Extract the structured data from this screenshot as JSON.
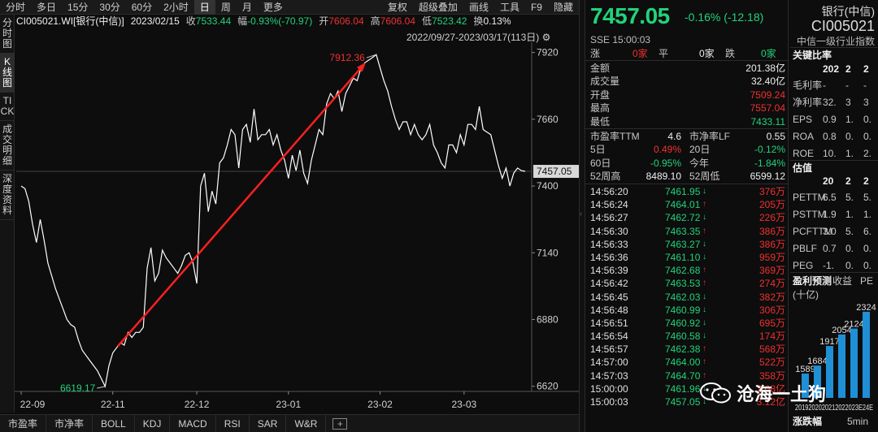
{
  "toolbar": {
    "items": [
      "分时",
      "多日",
      "15分",
      "30分",
      "60分",
      "2小时",
      "日",
      "周",
      "月",
      "更多"
    ],
    "active": "日",
    "right": [
      "复权",
      "超级叠加",
      "画线",
      "工具",
      "F9",
      "隐藏"
    ]
  },
  "leftnav": [
    "分时图",
    "K线图",
    "TICK",
    "成交明细",
    "深度资料"
  ],
  "leftnav_active": "K线图",
  "infobar": {
    "code": "CI005021.WI[银行(中信)]",
    "date": "2023/02/15",
    "close_label": "收",
    "close": "7533.44",
    "chg_label": "幅",
    "chg": "-0.93%(-70.97)",
    "open_label": "开",
    "open": "7606.04",
    "high_label": "高",
    "high": "7606.04",
    "low_label": "低",
    "low": "7523.42",
    "turnover_label": "换",
    "turnover": "0.13%"
  },
  "range": "2022/09/27-2023/03/17(113日)",
  "chart_data": {
    "type": "line",
    "y_ticks": [
      7920,
      7660,
      7400,
      7140,
      6880,
      6620
    ],
    "x_ticks": [
      "22-09",
      "22-11",
      "22-12",
      "23-01",
      "23-02",
      "23-03"
    ],
    "ylim": [
      6600,
      7960
    ],
    "last_price_label": "7457.05",
    "max_annotation": "7912.36",
    "min_annotation": "6619.17",
    "values": [
      7400,
      7390,
      7340,
      7250,
      7180,
      7270,
      7190,
      7100,
      7050,
      7000,
      6960,
      6920,
      6880,
      6860,
      6850,
      6800,
      6760,
      6740,
      6720,
      6700,
      6680,
      6650,
      6619,
      6700,
      6750,
      6770,
      6790,
      6780,
      6830,
      6810,
      6830,
      6830,
      6850,
      7080,
      7160,
      7030,
      7060,
      7150,
      7120,
      7100,
      7080,
      7060,
      7090,
      7130,
      7140,
      7100,
      7020,
      7400,
      7450,
      7300,
      7380,
      7330,
      7490,
      7510,
      7560,
      7620,
      7600,
      7470,
      7620,
      7640,
      7570,
      7700,
      7580,
      7600,
      7600,
      7620,
      7560,
      7600,
      7540,
      7500,
      7430,
      7520,
      7460,
      7540,
      7450,
      7410,
      7500,
      7560,
      7620,
      7600,
      7720,
      7760,
      7740,
      7770,
      7690,
      7760,
      7790,
      7820,
      7810,
      7860,
      7880,
      7890,
      7900,
      7912,
      7860,
      7810,
      7770,
      7710,
      7660,
      7620,
      7650,
      7650,
      7600,
      7640,
      7600,
      7580,
      7600,
      7640,
      7560,
      7530,
      7490,
      7470,
      7560,
      7560,
      7530,
      7600,
      7560,
      7640,
      7640,
      7620,
      7710,
      7620,
      7610,
      7600,
      7540,
      7480,
      7430,
      7470,
      7400,
      7450,
      7470,
      7460,
      7457
    ],
    "trendline": {
      "from_index": 24,
      "to_index": 92
    }
  },
  "bottom_tabs": [
    "市盈率",
    "市净率",
    "BOLL",
    "KDJ",
    "MACD",
    "RSI",
    "SAR",
    "W&R",
    "+"
  ],
  "quote": {
    "price": "7457.05",
    "change": "-0.16% (-12.18)",
    "exchange": "SSE 15:00:03",
    "up_label": "涨",
    "up": "0家",
    "flat_label": "平",
    "flat": "0家",
    "down_label": "跌",
    "down": "0家",
    "rows": [
      {
        "label": "金额",
        "value": "201.38亿",
        "color": "white"
      },
      {
        "label": "成交量",
        "value": "32.40亿",
        "color": "white"
      },
      {
        "label": "开盘",
        "value": "7509.24",
        "color": "red"
      },
      {
        "label": "最高",
        "value": "7557.04",
        "color": "red"
      },
      {
        "label": "最低",
        "value": "7433.11",
        "color": "green"
      }
    ],
    "ratios": [
      {
        "l1": "市盈率TTM",
        "v1": "4.6",
        "c1": "white",
        "l2": "市净率LF",
        "v2": "0.55",
        "c2": "white"
      },
      {
        "l1": "5日",
        "v1": "0.49%",
        "c1": "red",
        "l2": "20日",
        "v2": "-0.12%",
        "c2": "green"
      },
      {
        "l1": "60日",
        "v1": "-0.95%",
        "c1": "green",
        "l2": "今年",
        "v2": "-1.84%",
        "c2": "green"
      },
      {
        "l1": "52周高",
        "v1": "8489.10",
        "c1": "white",
        "l2": "52周低",
        "v2": "6599.12",
        "c2": "white"
      }
    ],
    "trades": [
      {
        "time": "14:56:20",
        "price": "7461.95",
        "dir": "down",
        "vol": "376万"
      },
      {
        "time": "14:56:24",
        "price": "7464.01",
        "dir": "up",
        "vol": "205万"
      },
      {
        "time": "14:56:27",
        "price": "7462.72",
        "dir": "down",
        "vol": "226万"
      },
      {
        "time": "14:56:30",
        "price": "7463.35",
        "dir": "up",
        "vol": "386万"
      },
      {
        "time": "14:56:33",
        "price": "7463.27",
        "dir": "down",
        "vol": "386万"
      },
      {
        "time": "14:56:36",
        "price": "7461.10",
        "dir": "down",
        "vol": "959万"
      },
      {
        "time": "14:56:39",
        "price": "7462.68",
        "dir": "up",
        "vol": "369万"
      },
      {
        "time": "14:56:42",
        "price": "7463.53",
        "dir": "up",
        "vol": "274万"
      },
      {
        "time": "14:56:45",
        "price": "7462.03",
        "dir": "down",
        "vol": "382万"
      },
      {
        "time": "14:56:48",
        "price": "7460.99",
        "dir": "down",
        "vol": "306万"
      },
      {
        "time": "14:56:51",
        "price": "7460.92",
        "dir": "down",
        "vol": "695万"
      },
      {
        "time": "14:56:54",
        "price": "7460.58",
        "dir": "down",
        "vol": "174万"
      },
      {
        "time": "14:56:57",
        "price": "7462.38",
        "dir": "up",
        "vol": "568万"
      },
      {
        "time": "14:57:00",
        "price": "7464.00",
        "dir": "up",
        "vol": "522万"
      },
      {
        "time": "14:57:03",
        "price": "7464.70",
        "dir": "up",
        "vol": "358万"
      },
      {
        "time": "15:00:00",
        "price": "7461.96",
        "dir": "down",
        "vol": "2.08亿"
      },
      {
        "time": "15:00:03",
        "price": "7457.05",
        "dir": "down",
        "vol": "3.12亿"
      }
    ],
    "arrow_up": "↑",
    "arrow_down": "↓"
  },
  "fpanel": {
    "name": "银行(中信)",
    "code": "CI005021",
    "industry": "中信一级行业指数",
    "key_title": "关键比率",
    "key_header": [
      "202",
      "2",
      "2"
    ],
    "key_rows": [
      {
        "label": "毛利率",
        "v": [
          "-",
          "-",
          "-"
        ]
      },
      {
        "label": "净利率",
        "v": [
          "32.",
          "3",
          "3"
        ]
      },
      {
        "label": "EPS",
        "v": [
          "0.9",
          "1.",
          "0."
        ]
      },
      {
        "label": "ROA",
        "v": [
          "0.8",
          "0.",
          "0."
        ]
      },
      {
        "label": "ROE",
        "v": [
          "10.",
          "1.",
          "2."
        ]
      }
    ],
    "val_title": "估值",
    "val_header": [
      "20",
      "2",
      "2"
    ],
    "val_rows": [
      {
        "label": "PETTM",
        "v": [
          "6.5",
          "5.",
          "5."
        ]
      },
      {
        "label": "PSTTM",
        "v": [
          "1.9",
          "1.",
          "1."
        ]
      },
      {
        "label": "PCFTTM",
        "v": [
          "3.0",
          "5.",
          "6."
        ]
      },
      {
        "label": "PBLF",
        "v": [
          "0.7",
          "0.",
          "0."
        ]
      },
      {
        "label": "PEG",
        "v": [
          "-1.",
          "0.",
          "0."
        ]
      }
    ],
    "earn_title": "盈利预测",
    "earn_tabs": [
      "收益",
      "PE"
    ],
    "earn_unit": "(十亿)",
    "earn_values": [
      "1589",
      "1684",
      "1917",
      "2054",
      "2124",
      "2324"
    ],
    "earn_years": "2019202020212022023E24E",
    "bottom_label": "涨跌幅",
    "bottom_right": "5min"
  },
  "watermark": "沧海一土狗",
  "colors": {
    "up": "#f03030",
    "down": "#21d37a",
    "line": "#ffffff",
    "trend": "#ff2020",
    "bar": "#1f8fd6"
  }
}
